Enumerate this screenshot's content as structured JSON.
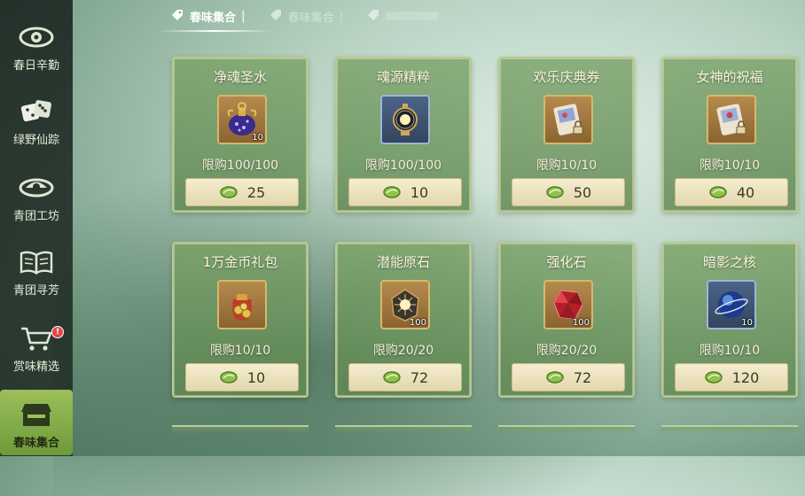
{
  "sidebar": {
    "items": [
      {
        "label": "春日辛勤",
        "icon": "eye-emblem-icon"
      },
      {
        "label": "绿野仙踪",
        "icon": "dice-icon"
      },
      {
        "label": "青团工坊",
        "icon": "eye-emblem-icon"
      },
      {
        "label": "青团寻芳",
        "icon": "book-icon"
      },
      {
        "label": "赏味精选",
        "icon": "cart-icon",
        "badge": "!"
      },
      {
        "label": "春味集合",
        "icon": "shop-icon"
      }
    ],
    "active_index": 5
  },
  "tabs": [
    {
      "label": "春味集合",
      "active": true
    },
    {
      "label": "春味集合",
      "active": false
    },
    {
      "label": "",
      "active": false
    }
  ],
  "shop": {
    "items": [
      {
        "name": "净魂圣水",
        "qty": "10",
        "limit": "限购100/100",
        "price": "25",
        "icon": "potion-flask-icon"
      },
      {
        "name": "魂源精粹",
        "qty": "",
        "limit": "限购100/100",
        "price": "10",
        "icon": "soul-lantern-icon"
      },
      {
        "name": "欢乐庆典券",
        "qty": "",
        "limit": "限购10/10",
        "price": "50",
        "icon": "ticket-lock-icon"
      },
      {
        "name": "女神的祝福",
        "qty": "",
        "limit": "限购10/10",
        "price": "40",
        "icon": "ticket-lock-icon"
      },
      {
        "name": "1万金币礼包",
        "qty": "",
        "limit": "限购10/10",
        "price": "10",
        "icon": "coin-bag-icon"
      },
      {
        "name": "潜能原石",
        "qty": "100",
        "limit": "限购20/20",
        "price": "72",
        "icon": "potential-stone-icon"
      },
      {
        "name": "强化石",
        "qty": "100",
        "limit": "限购20/20",
        "price": "72",
        "icon": "red-gem-icon"
      },
      {
        "name": "暗影之核",
        "qty": "10",
        "limit": "限购10/10",
        "price": "120",
        "icon": "shadow-orb-icon"
      }
    ]
  },
  "colors": {
    "accent_green": "#8fb552",
    "card_border": "#b9c98a",
    "price_bg": "#efe6c3"
  }
}
